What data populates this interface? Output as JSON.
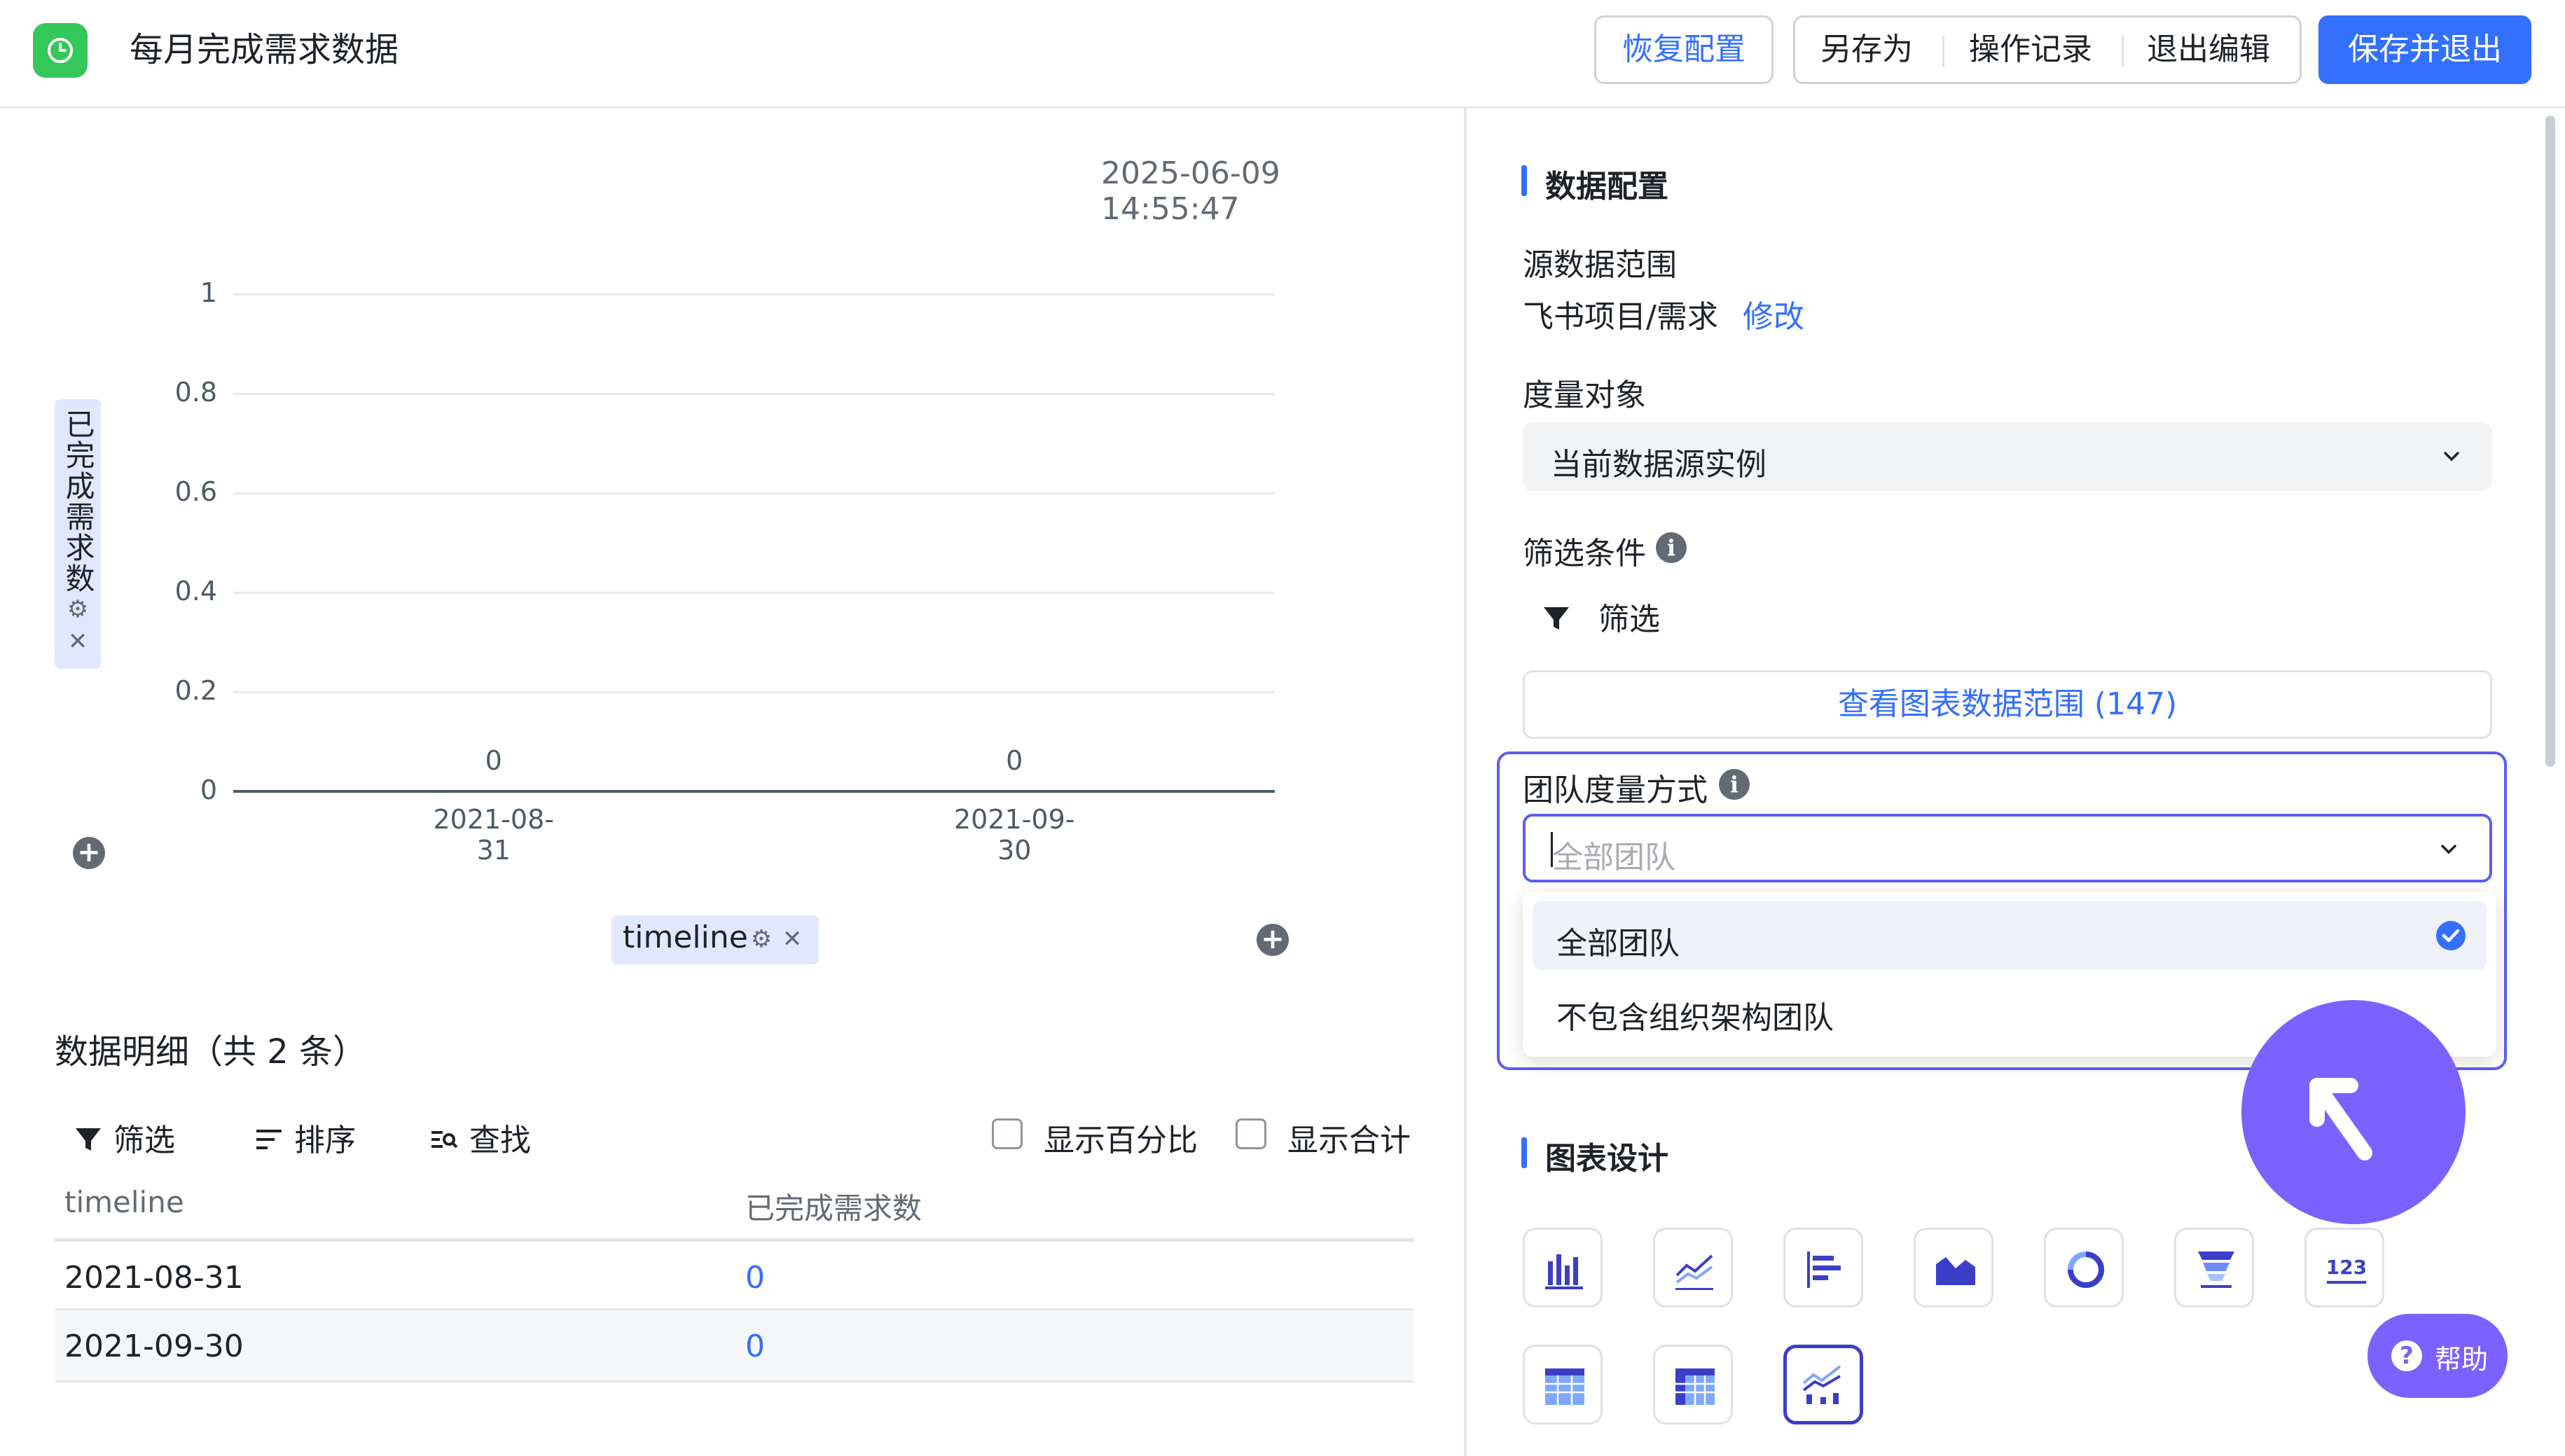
{
  "header": {
    "title": "每月完成需求数据",
    "restore_label": "恢复配置",
    "save_as_label": "另存为",
    "history_label": "操作记录",
    "exit_edit_label": "退出编辑",
    "save_exit_label": "保存并退出",
    "accent_color": "#3370ff"
  },
  "chart": {
    "timestamp": "2025-06-09 14:55:47",
    "y_field": "已完成需求数",
    "x_field": "timeline"
  },
  "chart_data": {
    "type": "bar",
    "categories": [
      "2021-08-31",
      "2021-09-30"
    ],
    "series": [
      {
        "name": "已完成需求数",
        "values": [
          0,
          0
        ]
      }
    ],
    "ylabel": "已完成需求数",
    "xlabel": "timeline",
    "ylim": [
      0,
      1
    ],
    "yticks": [
      "0",
      "0.2",
      "0.4",
      "0.6",
      "0.8",
      "1"
    ],
    "grid": true
  },
  "details": {
    "title": "数据明细（共 2 条）",
    "filter_label": "筛选",
    "sort_label": "排序",
    "find_label": "查找",
    "show_percent_label": "显示百分比",
    "show_total_label": "显示合计",
    "columns": [
      "timeline",
      "已完成需求数"
    ],
    "rows": [
      [
        "2021-08-31",
        "0"
      ],
      [
        "2021-09-30",
        "0"
      ]
    ]
  },
  "config": {
    "data_section_title": "数据配置",
    "source_range_label": "源数据范围",
    "source_value": "飞书项目/需求",
    "modify_label": "修改",
    "measure_label": "度量对象",
    "measure_value": "当前数据源实例",
    "filter_cond_label": "筛选条件",
    "filter_label": "筛选",
    "view_range_label": "查看图表数据范围 (147)",
    "team_label": "团队度量方式",
    "team_placeholder": "全部团队",
    "team_options": [
      "全部团队",
      "不包含组织架构团队"
    ],
    "team_selected": "全部团队",
    "design_section_title": "图表设计",
    "chart_types": [
      "bar-chart-icon",
      "line-chart-icon",
      "horizontal-bar-icon",
      "area-chart-icon",
      "donut-chart-icon",
      "funnel-chart-icon",
      "number-card-icon",
      "table-icon",
      "pivot-table-icon",
      "combo-chart-icon"
    ],
    "help_label": "帮助"
  }
}
